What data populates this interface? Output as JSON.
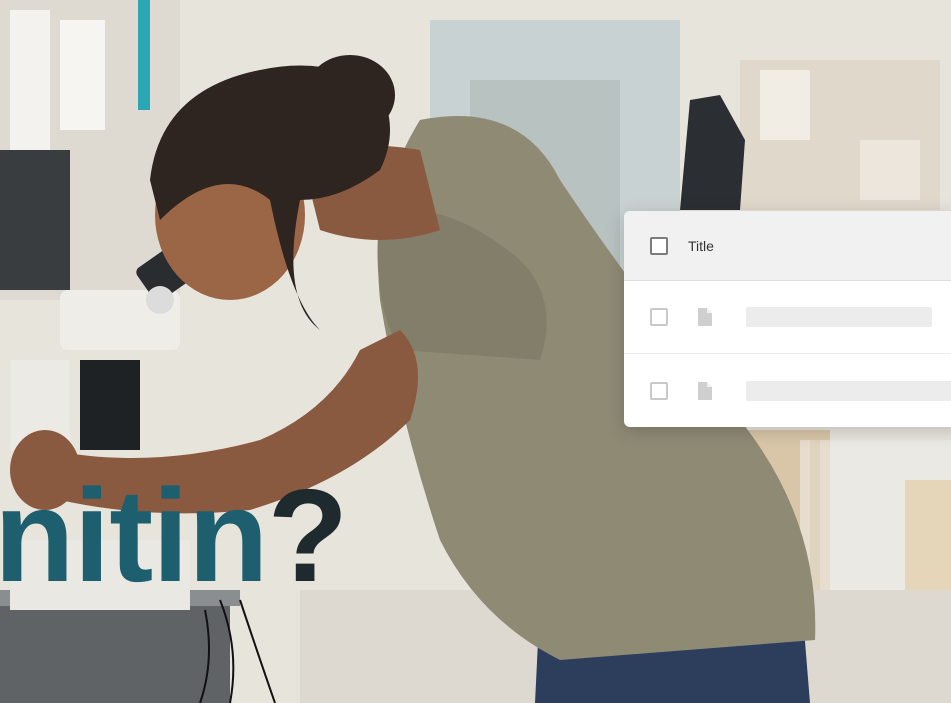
{
  "hero": {
    "headline_text": "nitin",
    "headline_punct": "?",
    "headline_color": "#1d5f6e",
    "punct_color": "#1f2a2e"
  },
  "file_table": {
    "header_title": "Title",
    "rows": [
      {
        "icon": "document-icon"
      },
      {
        "icon": "document-icon"
      }
    ]
  },
  "photo": {
    "subject": "student-using-microscope"
  }
}
